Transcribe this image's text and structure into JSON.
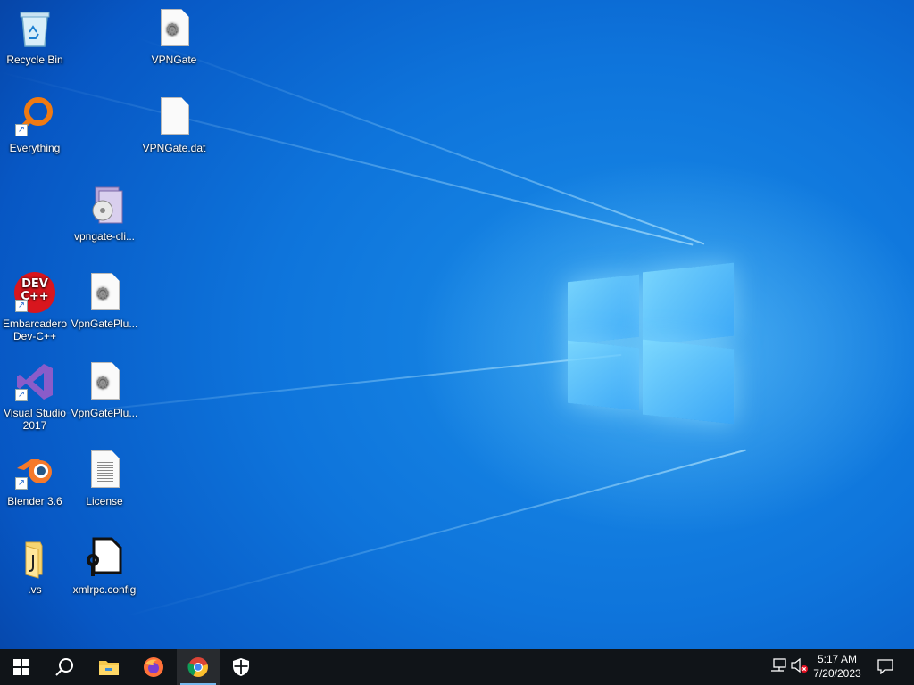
{
  "desktop": {
    "icons": [
      {
        "label": "Recycle Bin",
        "icon": "recycle-bin-icon"
      },
      {
        "label": "VPNGate",
        "icon": "config-file-icon"
      },
      {
        "label": "Everything",
        "icon": "everything-search-icon"
      },
      {
        "label": "VPNGate.dat",
        "icon": "blank-file-icon"
      },
      {
        "label": "vpngate-cli...",
        "icon": "installer-icon"
      },
      {
        "label": "Embarcadero Dev-C++",
        "icon": "devcpp-icon",
        "badge": "DEV C++"
      },
      {
        "label": "VpnGatePlu...",
        "icon": "config-file-icon"
      },
      {
        "label": "Visual Studio 2017",
        "icon": "visual-studio-icon"
      },
      {
        "label": "VpnGatePlu...",
        "icon": "config-file-icon"
      },
      {
        "label": "Blender 3.6",
        "icon": "blender-icon"
      },
      {
        "label": "License",
        "icon": "text-file-icon"
      },
      {
        "label": ".vs",
        "icon": "folder-icon"
      },
      {
        "label": "xmlrpc.config",
        "icon": "config-settings-icon"
      }
    ]
  },
  "taskbar": {
    "buttons": [
      "start-icon",
      "search-icon",
      "file-explorer-icon",
      "firefox-icon",
      "chrome-icon",
      "security-shield-icon"
    ],
    "active": "chrome-icon",
    "tray": [
      "network-icon",
      "volume-muted-icon"
    ],
    "time": "5:17 AM",
    "date": "7/20/2023",
    "notification_icon": "action-center-icon"
  },
  "colors": {
    "accent": "#0a6fd6",
    "taskbar": "#101418"
  }
}
